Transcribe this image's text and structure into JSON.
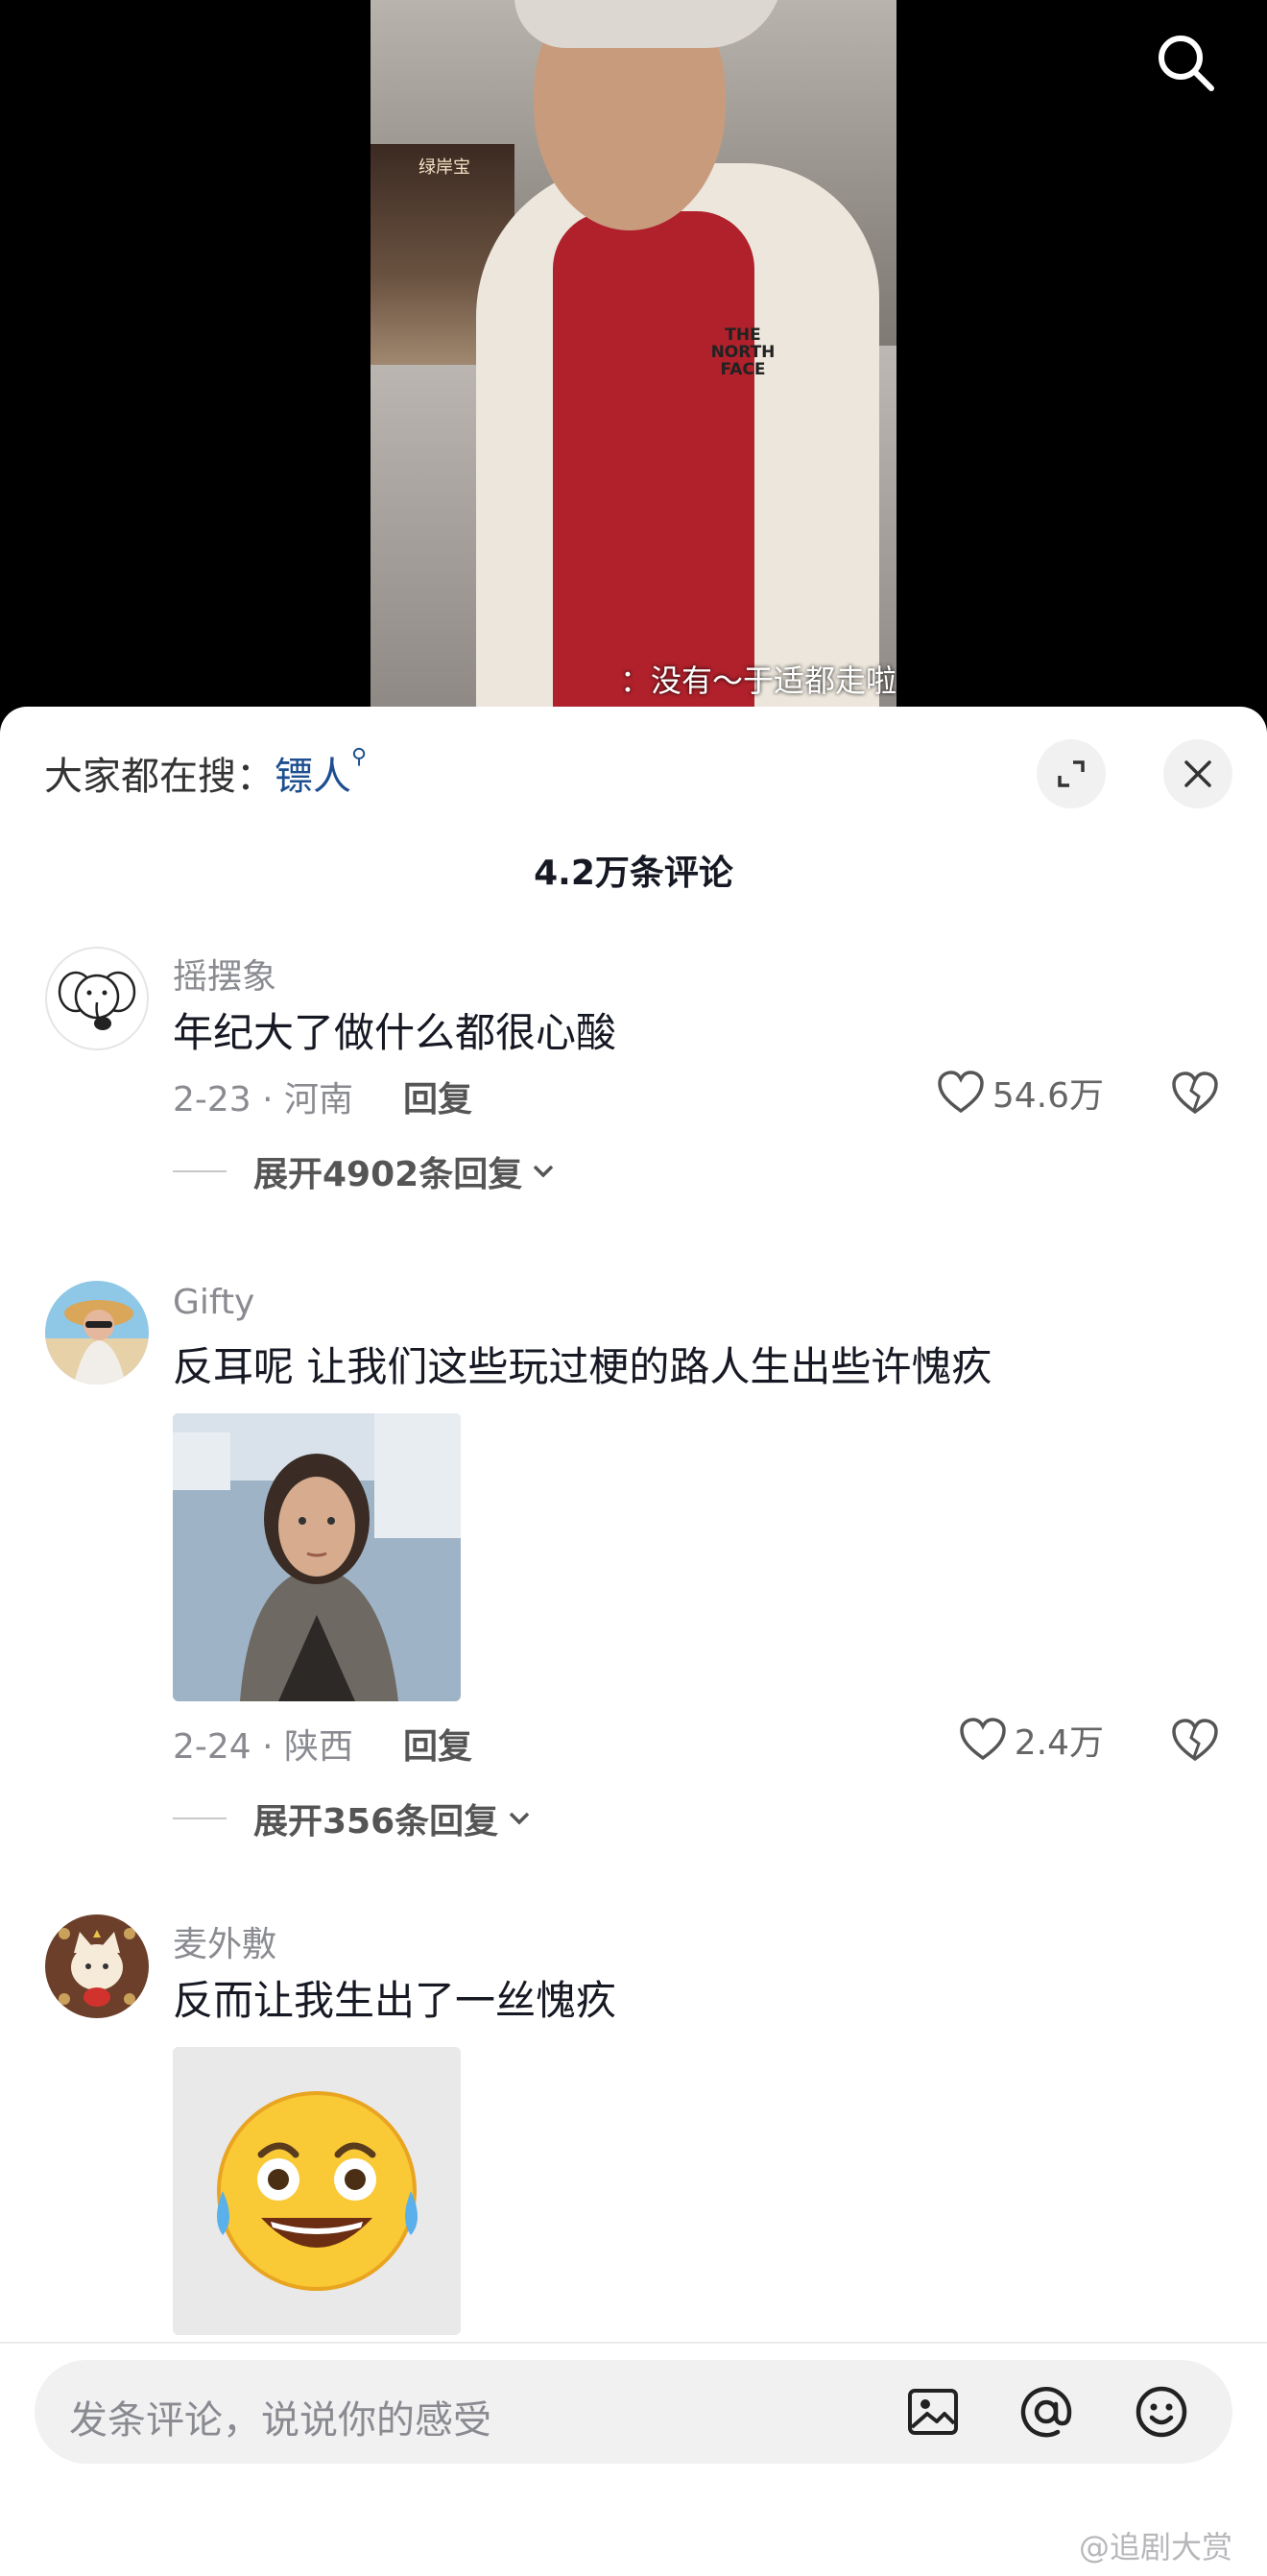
{
  "video": {
    "subtitle": "：没有～于适都走啦",
    "shop_sign": "绿岸宝",
    "jacket_logo": "THE NORTH FACE"
  },
  "sheet": {
    "search_prefix": "大家都在搜：",
    "search_keyword": "镖人",
    "comment_count": "4.2万条评论"
  },
  "comments": [
    {
      "username": "摇摆象",
      "text": "年纪大了做什么都很心酸",
      "meta": "2-23 · 河南",
      "reply": "回复",
      "likes": "54.6万",
      "expand": "展开4902条回复"
    },
    {
      "username": "Gifty",
      "text": "反耳呢 让我们这些玩过梗的路人生出些许愧疚",
      "meta": "2-24 · 陕西",
      "reply": "回复",
      "likes": "2.4万",
      "expand": "展开356条回复"
    },
    {
      "username": "麦外敷",
      "text": "反而让我生出了一丝愧疚"
    }
  ],
  "input": {
    "placeholder": "发条评论，说说你的感受"
  },
  "watermark": "@追剧大赏",
  "colors": {
    "keyword": "#1d4e8f",
    "sheet_bg": "#ffffff",
    "muted": "#8a8b91"
  }
}
